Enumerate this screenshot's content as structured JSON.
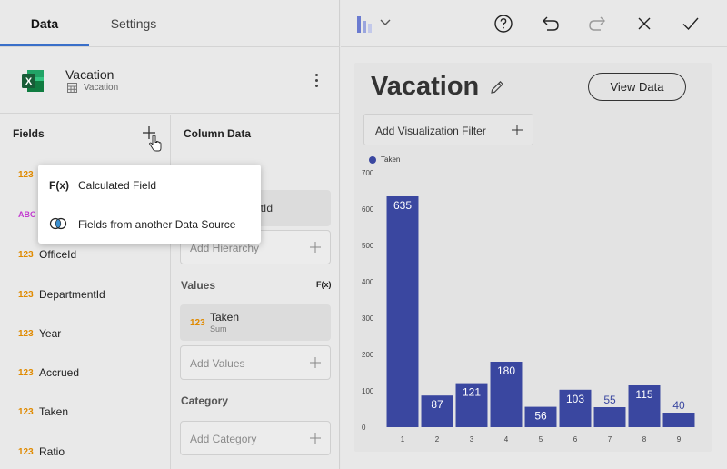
{
  "tabs": [
    {
      "label": "Data",
      "active": true
    },
    {
      "label": "Settings",
      "active": false
    }
  ],
  "source": {
    "title": "Vacation",
    "subtitle": "Vacation"
  },
  "fields_panel": {
    "title": "Fields",
    "items": [
      {
        "type": "123",
        "name": ""
      },
      {
        "type": "ABC",
        "name": ""
      },
      {
        "type": "123",
        "name": "OfficeId"
      },
      {
        "type": "123",
        "name": "DepartmentId"
      },
      {
        "type": "123",
        "name": "Year"
      },
      {
        "type": "123",
        "name": "Accrued"
      },
      {
        "type": "123",
        "name": "Taken"
      },
      {
        "type": "123",
        "name": "Ratio"
      }
    ]
  },
  "popup_menu": {
    "items": [
      {
        "icon_text": "F(x)",
        "label": "Calculated Field"
      },
      {
        "icon_text": "",
        "label": "Fields from another Data Source"
      }
    ]
  },
  "column_data": {
    "title": "Column Data",
    "chip_partial": "ntId",
    "add_hierarchy": "Add Hierarchy",
    "values_title": "Values",
    "values_fx": "F(x)",
    "value_chip": {
      "type": "123",
      "name": "Taken",
      "sub": "Sum"
    },
    "add_values": "Add Values",
    "category_title": "Category",
    "add_category": "Add Category"
  },
  "viz": {
    "title": "Vacation",
    "view_data": "View Data",
    "filter_label": "Add Visualization Filter"
  },
  "colors": {
    "accent": "#3a6fc9",
    "bar": "#3a47a0",
    "type_number": "#e08a00",
    "type_text": "#c23bd0"
  },
  "chart_data": {
    "type": "bar",
    "categories": [
      "1",
      "2",
      "3",
      "4",
      "5",
      "6",
      "7",
      "8",
      "9"
    ],
    "series": [
      {
        "name": "Taken",
        "values": [
          635,
          87,
          121,
          180,
          56,
          103,
          55,
          115,
          40
        ]
      }
    ],
    "ylim": [
      0,
      700
    ],
    "y_ticks": [
      "0",
      "100",
      "200",
      "300",
      "400",
      "500",
      "600",
      "700"
    ],
    "legend": "top-left",
    "grid": false
  }
}
